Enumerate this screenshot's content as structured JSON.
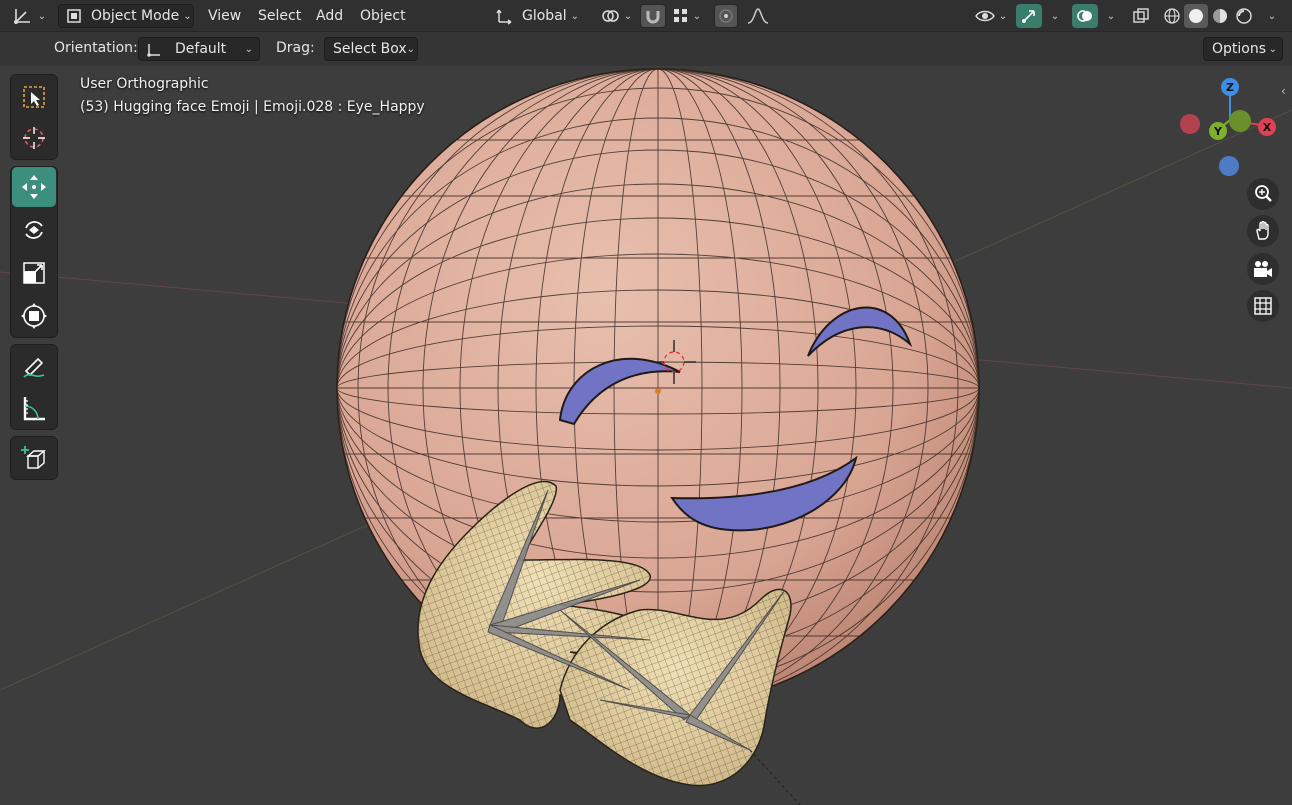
{
  "header": {
    "editor_type_icon": "axis-icon",
    "mode": "Object Mode",
    "menus": [
      "View",
      "Select",
      "Add",
      "Object"
    ],
    "transform_orientation": "Global"
  },
  "tool_header": {
    "orientation_label": "Orientation:",
    "orientation_value": "Default",
    "drag_label": "Drag:",
    "drag_value": "Select Box",
    "options_label": "Options"
  },
  "viewport": {
    "view_name": "User Orthographic",
    "object_info": "(53) Hugging face Emoji | Emoji.028 : Eye_Happy"
  },
  "gizmo": {
    "x_label": "X",
    "y_label": "Y",
    "z_label": "Z",
    "colors": {
      "x": "#e04152",
      "y": "#7fb02a",
      "z": "#3d8ee6",
      "neg_x": "#b3424f",
      "neg_y": "#6a8f2d",
      "neg_z": "#4d7bc4"
    }
  },
  "colors": {
    "accent": "#3d8f7d",
    "mesh": "#dcaa98",
    "wire": "#232323",
    "eyes": "#7173c4",
    "hand": "#e6d2a0"
  }
}
